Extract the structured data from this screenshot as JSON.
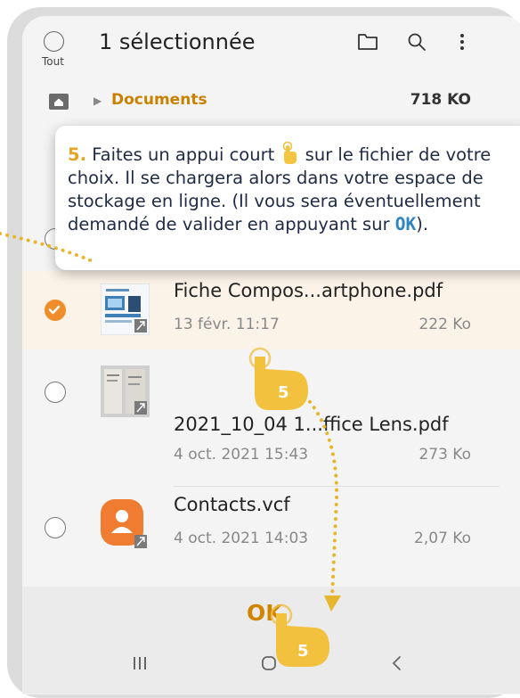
{
  "header": {
    "selected_label": "1 sélectionnée",
    "select_all_label": "Tout"
  },
  "breadcrumb": {
    "folder": "Documents",
    "size": "718 KO"
  },
  "files": [
    {
      "name": "Fiche Compos...artphone.pdf",
      "date": "13 févr. 11:17",
      "size": "222 Ko",
      "selected": true
    },
    {
      "name": "2021_10_04 1...ffice Lens.pdf",
      "date": "4 oct. 2021 15:43",
      "size": "273 Ko",
      "selected": false
    },
    {
      "name": "Contacts.vcf",
      "date": "4 oct. 2021 14:03",
      "size": "2,07 Ko",
      "selected": false
    }
  ],
  "ok_label": "OK",
  "tooltip": {
    "step": "5.",
    "text_before": "Faites un appui court",
    "text_after": "sur le fichier de votre choix. Il se chargera alors dans votre espace de stockage en ligne. (Il vous sera éventuellement demandé de valider en appuyant sur",
    "ok_word": "OK",
    "text_end": ")."
  },
  "tap_markers": [
    "5",
    "5"
  ],
  "colors": {
    "accent_orange": "#ef8d2a",
    "ok_text": "#d08400",
    "step_number": "#e2a525",
    "ok_highlight": "#2e86c1",
    "selected_row_bg": "#fbf3e7"
  }
}
